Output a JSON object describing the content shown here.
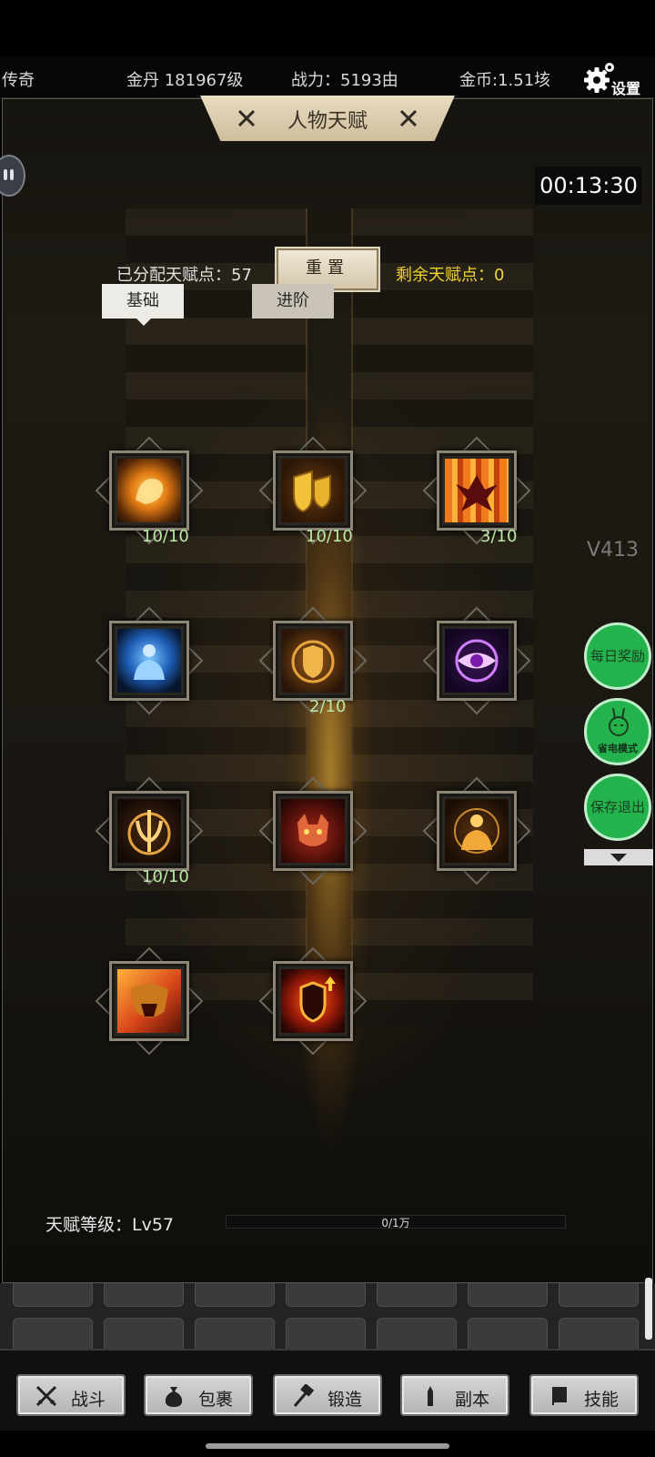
{
  "header": {
    "rank": "传奇",
    "gold_dan": "金丹 181967级",
    "power": "战力：5193由",
    "coins": "金币:1.51垓",
    "settings_label": "设置"
  },
  "page_title": "人物天赋",
  "timer": "00:13:30",
  "allocation": {
    "allocated_label": "已分配天赋点：57",
    "reset_label": "重置",
    "remaining_label": "剩余天赋点：0"
  },
  "tabs": [
    {
      "label": "基础",
      "active": true
    },
    {
      "label": "进阶",
      "active": false
    }
  ],
  "talents": [
    {
      "icon": "flaming-fist-icon",
      "level": "10/10"
    },
    {
      "icon": "golden-shields-icon",
      "level": "10/10"
    },
    {
      "icon": "phoenix-banner-icon",
      "level": "3/10"
    },
    {
      "icon": "blue-meditation-icon",
      "level": ""
    },
    {
      "icon": "glowing-shield-icon",
      "level": "2/10"
    },
    {
      "icon": "purple-eye-icon",
      "level": ""
    },
    {
      "icon": "trident-sigil-icon",
      "level": "10/10"
    },
    {
      "icon": "demon-mask-icon",
      "level": ""
    },
    {
      "icon": "golden-body-icon",
      "level": ""
    },
    {
      "icon": "roaring-lion-icon",
      "level": ""
    },
    {
      "icon": "shield-upgrade-icon",
      "level": ""
    }
  ],
  "version": "V413",
  "side_buttons": {
    "daily_reward": "每日奖励",
    "power_save": "省电模式",
    "save_exit": "保存退出"
  },
  "talent_level": {
    "label": "天赋等级：Lv57",
    "progress_text": "0/1万",
    "progress_fraction": 0
  },
  "bottom_nav": [
    {
      "label": "战斗",
      "icon": "crossed-swords-icon"
    },
    {
      "label": "包裹",
      "icon": "money-bag-icon"
    },
    {
      "label": "锻造",
      "icon": "hammer-icon"
    },
    {
      "label": "副本",
      "icon": "tower-icon"
    },
    {
      "label": "技能",
      "icon": "skill-book-icon"
    }
  ],
  "colors": {
    "accent_yellow": "#f2d530",
    "level_green": "#b9eaa6",
    "side_button_green": "#24b24c"
  }
}
